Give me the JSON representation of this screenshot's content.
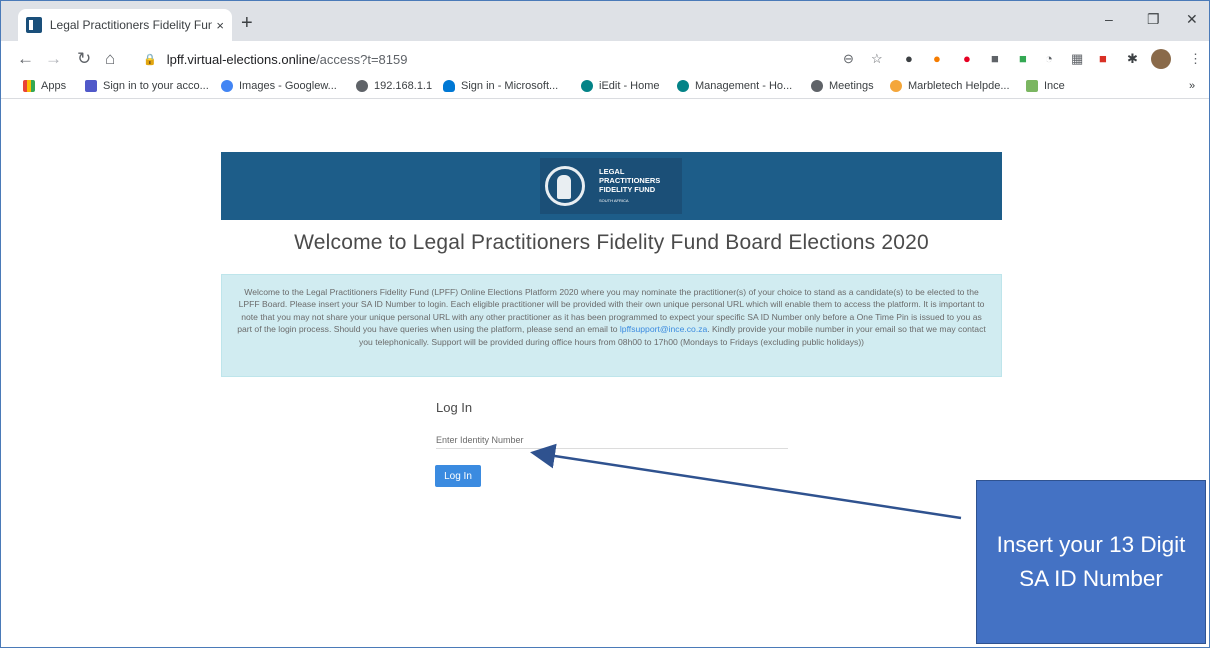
{
  "browser": {
    "tab_title": "Legal Practitioners Fidelity Fund | ",
    "tab_close": "×",
    "new_tab": "+",
    "url_host": "lpff.virtual-elections.online",
    "url_path": "/access?t=8159",
    "minimize": "–",
    "restore": "❐",
    "close": "✕"
  },
  "bookmarks": [
    {
      "label": "Apps",
      "color": "#ea4335"
    },
    {
      "label": "Sign in to your acco...",
      "color": "#5059c9"
    },
    {
      "label": "Images - Googlew...",
      "color": "#4285f4"
    },
    {
      "label": "192.168.1.1",
      "color": "#5f6368"
    },
    {
      "label": "Sign in - Microsoft...",
      "color": "#0078d4"
    },
    {
      "label": "iEdit - Home",
      "color": "#038387"
    },
    {
      "label": "Management - Ho...",
      "color": "#038387"
    },
    {
      "label": "Meetings",
      "color": "#5f6368"
    },
    {
      "label": "Marbletech Helpde...",
      "color": "#f4a63a"
    },
    {
      "label": "Ince",
      "color": "#7bb661"
    }
  ],
  "bookmarks_more": "»",
  "logo": {
    "line1": "LEGAL",
    "line2": "PRACTITIONERS",
    "line3": "FIDELITY FUND",
    "line4": "SOUTH AFRICA"
  },
  "page": {
    "heading": "Welcome to Legal Practitioners Fidelity Fund Board Elections 2020",
    "notice_part1": "Welcome to the Legal Practitioners Fidelity Fund (LPFF) Online Elections Platform 2020 where you may nominate the practitioner(s) of your choice to stand as a candidate(s) to be elected to the LPFF Board. Please insert your SA ID Number to login. Each eligible practitioner will be provided with their own unique personal URL which will enable them to access the platform. It is important to note that you may not share your unique personal URL with any other practitioner as it has been programmed to expect your specific SA ID Number only before a One Time Pin is issued to you as part of the login process. Should you have queries when using the platform, please send an email to ",
    "notice_email": "lpffsupport@ince.co.za",
    "notice_part2": ". Kindly provide your mobile number in your email so that we may contact you telephonically. Support will be provided during office hours from 08h00 to 17h00 (Mondays to Fridays (excluding public holidays))",
    "login_title": "Log In",
    "id_placeholder": "Enter Identity Number",
    "login_button": "Log In"
  },
  "callout": {
    "text": "Insert your 13 Digit SA ID Number",
    "color": "#4472c4",
    "arrow_color": "#2f528f"
  }
}
